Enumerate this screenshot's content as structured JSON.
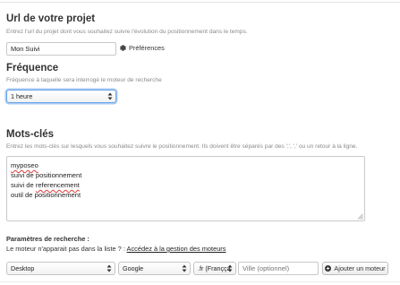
{
  "project_url": {
    "title": "Url de votre projet",
    "help": "Entrez l'url du projet dont vous souhaitez suivre l'évolution du positionnement dans le temps.",
    "value": "Mon Suivi",
    "preferences_label": "Préférences"
  },
  "frequency": {
    "title": "Fréquence",
    "help": "Fréquence à laquelle sera interrogé le moteur de recherche",
    "selected": "1 heure"
  },
  "keywords": {
    "title": "Mots-clés",
    "help": "Entrez les mots-clés sur lesquels vous souhaitez suivre le positionnement. Ils doivent être séparés par des ';', ',' ou un retour à la ligne.",
    "lines": [
      {
        "pre": "",
        "misspelled": "myposeo",
        "post": ""
      },
      {
        "pre": "suivi de positionnement",
        "misspelled": "",
        "post": ""
      },
      {
        "pre": "suivi de ",
        "misspelled": "referencement",
        "post": ""
      },
      {
        "pre": "outil de positionnement",
        "misspelled": "",
        "post": ""
      }
    ]
  },
  "search_params": {
    "title": "Paramètres de recherche :",
    "missing_engine_text": "Le moteur n'apparait pas dans la liste ? :",
    "missing_engine_link": "Accédez à la gestion des moteurs",
    "device": "Desktop",
    "engine": "Google",
    "locale": ".fr (Françça",
    "city_placeholder": "Ville (optionnel)",
    "add_engine_label": "Ajouter un moteur"
  },
  "colors": {
    "focus_ring": "#6aa3e8",
    "misspelling_underline": "#e23a3a",
    "heading_text": "#333333",
    "help_text": "#8a8a8a"
  }
}
